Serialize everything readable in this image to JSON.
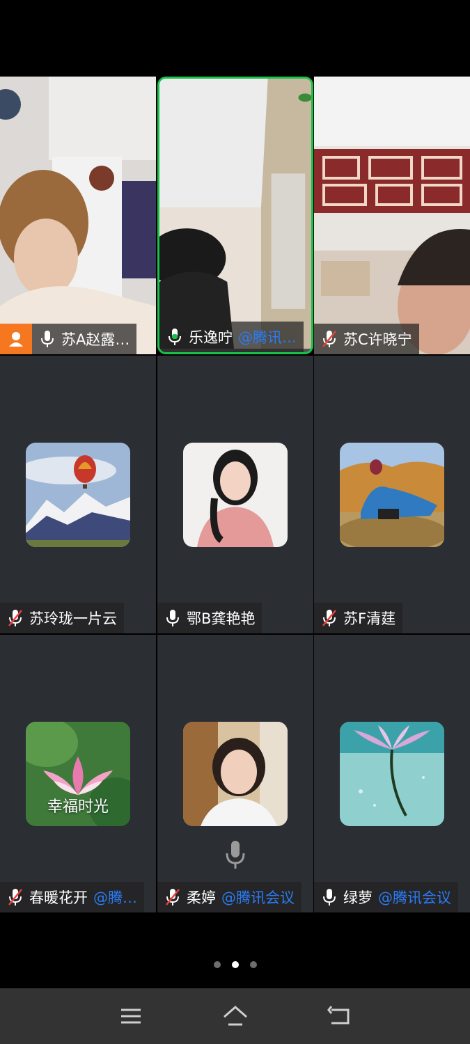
{
  "participants": [
    {
      "name": "苏A赵露…",
      "org": "",
      "mic": "on",
      "host": true,
      "speaking": false,
      "kind": "video"
    },
    {
      "name": "乐逸咛",
      "org": "@腾讯…",
      "mic": "active",
      "host": false,
      "speaking": true,
      "kind": "video"
    },
    {
      "name": "苏C许晓宁",
      "org": "",
      "mic": "muted",
      "host": false,
      "speaking": false,
      "kind": "video"
    },
    {
      "name": "苏玲珑一片云",
      "org": "",
      "mic": "muted",
      "host": false,
      "speaking": false,
      "kind": "avatar",
      "avatar": "hot-air-balloon-photo"
    },
    {
      "name": "鄂B龚艳艳",
      "org": "",
      "mic": "on",
      "host": false,
      "speaking": false,
      "kind": "avatar",
      "avatar": "woman-portrait-photo"
    },
    {
      "name": "苏F清莛",
      "org": "",
      "mic": "muted",
      "host": false,
      "speaking": false,
      "kind": "avatar",
      "avatar": "woman-on-haystack-photo"
    },
    {
      "name": "春暖花开",
      "org": "@腾…",
      "mic": "muted",
      "host": false,
      "speaking": false,
      "kind": "avatar",
      "avatar": "lotus-flower-photo",
      "avatar_caption": "幸福时光"
    },
    {
      "name": "柔婷",
      "org": "@腾讯会议",
      "mic": "muted",
      "host": false,
      "speaking": false,
      "kind": "avatar",
      "avatar": "woman-selfie-photo"
    },
    {
      "name": "绿萝",
      "org": "@腾讯会议",
      "mic": "on",
      "host": false,
      "speaking": false,
      "kind": "avatar",
      "avatar": "water-lily-photo"
    }
  ],
  "pagination": {
    "pages": 3,
    "current": 2
  },
  "nav": {
    "items": [
      "menu-icon",
      "home-icon",
      "back-icon"
    ]
  },
  "colors": {
    "speaking_border": "#17c14a",
    "host_badge": "#f5771f",
    "org_link": "#2a7cf4",
    "tile_bg": "#2b2e32"
  }
}
